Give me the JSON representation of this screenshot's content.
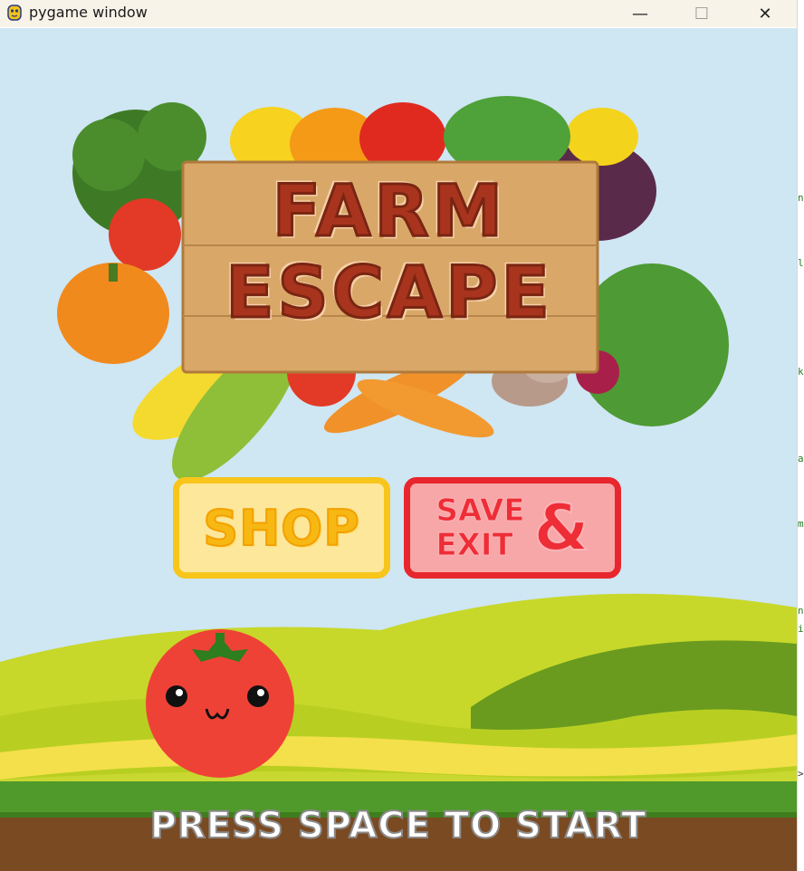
{
  "window": {
    "title": "pygame window",
    "controls": {
      "minimize": "—",
      "maximize": "☐",
      "close": "✕"
    }
  },
  "game": {
    "logo": {
      "line1": "FARM",
      "line2": "ESCAPE"
    },
    "buttons": {
      "shop": "SHOP",
      "save_exit": {
        "line1": "SAVE",
        "line2": "EXIT",
        "amp": "&"
      }
    },
    "prompt": "PRESS SPACE TO START",
    "character": "tomato-character"
  },
  "colors": {
    "sky": "#cfe6f3",
    "shop_fill": "#fde79a",
    "shop_border": "#f8c51b",
    "save_fill": "#f7a7a8",
    "save_border": "#e8262d",
    "sign_text": "#a8341e"
  },
  "background_app_glyphs": [
    "n",
    "l",
    "k",
    "a",
    "m",
    "n",
    "i",
    ">"
  ]
}
